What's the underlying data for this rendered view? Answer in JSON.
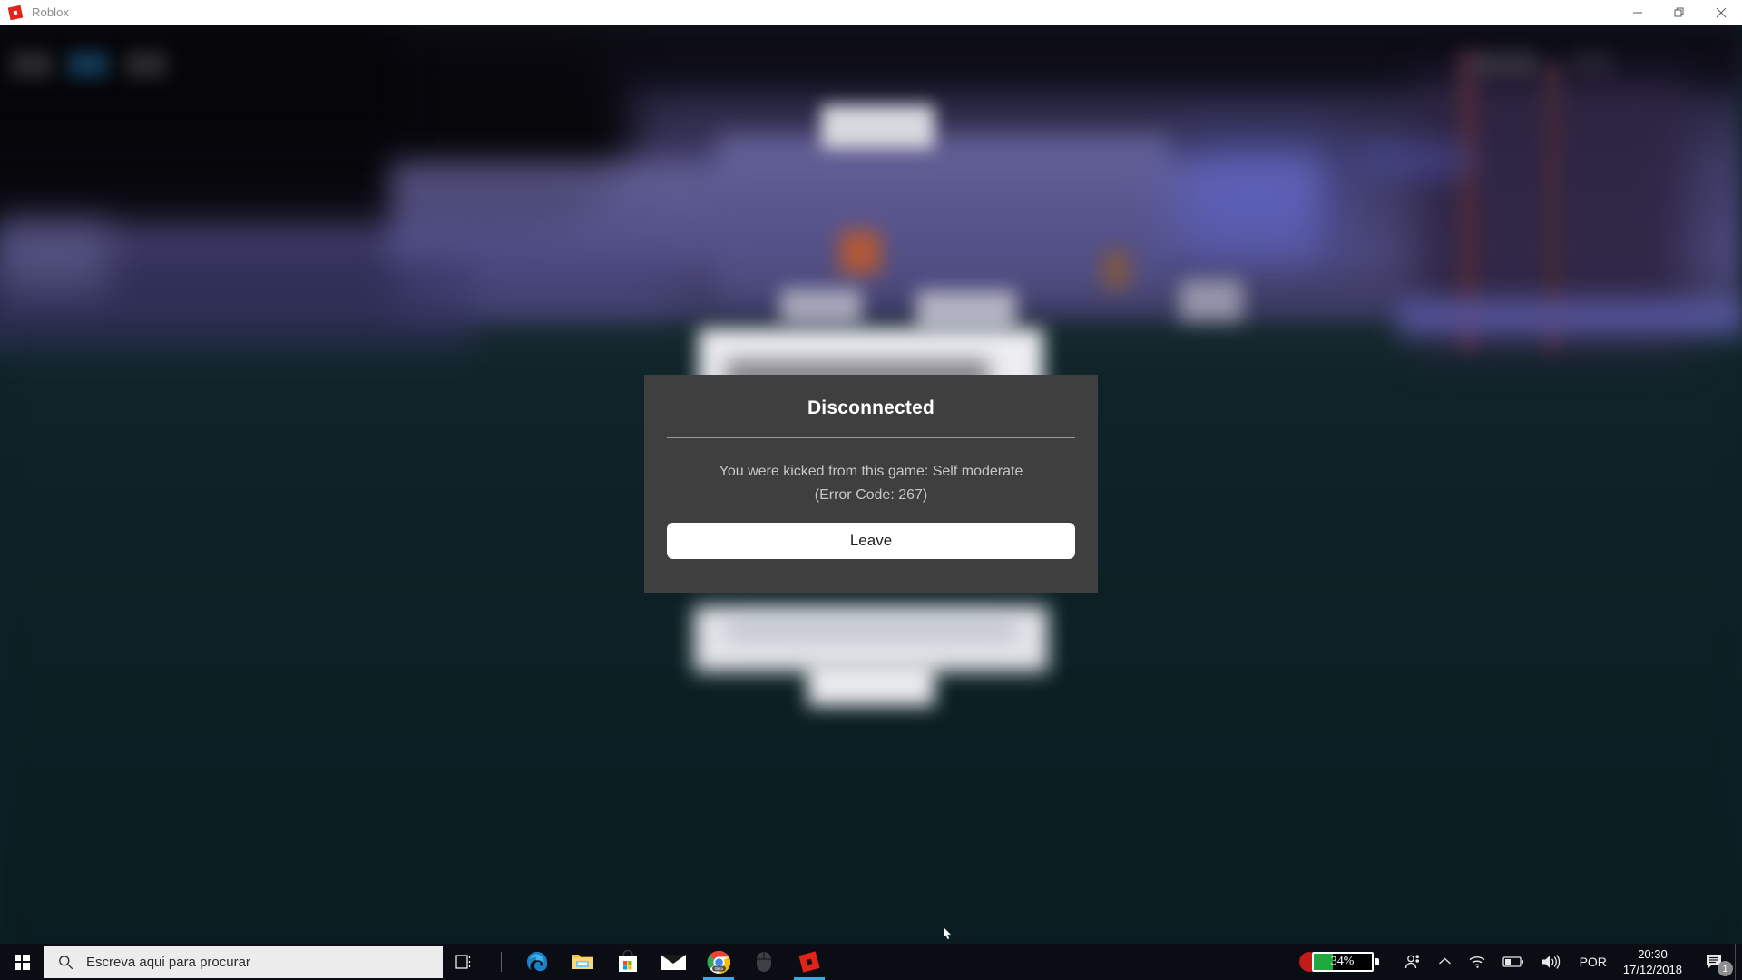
{
  "window": {
    "app_title": "Roblox",
    "logo_icon": "roblox-logo-icon",
    "controls": [
      {
        "name": "minimize",
        "icon": "minimize-icon"
      },
      {
        "name": "restore",
        "icon": "restore-icon"
      },
      {
        "name": "close",
        "icon": "close-icon"
      }
    ]
  },
  "dialog": {
    "title": "Disconnected",
    "message": "You were kicked from this game: Self moderate (Error Code: 267)",
    "message_line1": "You were kicked from this game: Self moderate",
    "message_line2": "(Error Code: 267)",
    "error_code": "267",
    "button_label": "Leave",
    "background_color": "#3f3f3f",
    "button_color": "#ffffff"
  },
  "game_background": {
    "description": "blurred Roblox game scene",
    "sky_color": "#4a4678",
    "ground_color": "#0d2226"
  },
  "taskbar": {
    "start_icon": "windows-start-icon",
    "search": {
      "icon": "search-icon",
      "placeholder": "Escreva aqui para procurar",
      "value": ""
    },
    "pinned": [
      {
        "name": "task-view",
        "icon": "task-view-icon",
        "active": false
      },
      {
        "name": "edge",
        "icon": "edge-icon",
        "active": false
      },
      {
        "name": "file-explorer",
        "icon": "file-explorer-icon",
        "active": false
      },
      {
        "name": "microsoft-store",
        "icon": "microsoft-store-icon",
        "active": false
      },
      {
        "name": "mail",
        "icon": "mail-icon",
        "active": false
      },
      {
        "name": "chrome-beta",
        "icon": "chrome-icon",
        "label": "Beta",
        "active": true
      },
      {
        "name": "mouse-settings",
        "icon": "mouse-icon",
        "active": false
      },
      {
        "name": "roblox",
        "icon": "roblox-icon",
        "active": true
      }
    ],
    "tray": {
      "battery_percent": "34%",
      "battery_level": 34,
      "people_icon": "people-icon",
      "chevron_icon": "chevron-up-icon",
      "wifi_icon": "wifi-icon",
      "battery_icon": "battery-icon",
      "volume_icon": "volume-icon",
      "language": "POR",
      "time": "20:30",
      "date": "17/12/2018",
      "notification_icon": "notification-icon",
      "notification_count": "1"
    }
  }
}
